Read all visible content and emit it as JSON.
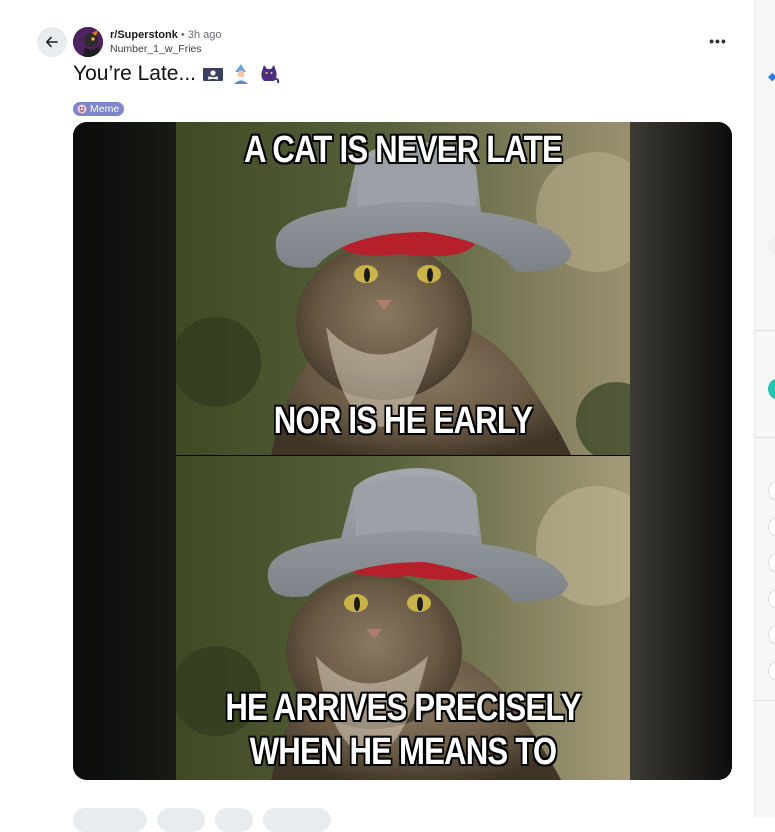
{
  "post": {
    "subreddit": "r/Superstonk",
    "separator": "•",
    "time_ago": "3h ago",
    "author": "Number_1_w_Fries",
    "title": "You’re Late...",
    "title_emojis": [
      "pirate-flag",
      "wizard",
      "black-cat"
    ],
    "flair": "Meme",
    "more_label": "•••"
  },
  "meme": {
    "top_caption_1": "A CAT IS NEVER LATE",
    "bottom_caption_1": "NOR IS HE EARLY",
    "top_caption_2": "HE ARRIVES PRECISELY",
    "bottom_caption_2": "WHEN HE MEANS TO"
  },
  "colors": {
    "flair_bg": "#7c86c8",
    "hat_gray": "#8e9398",
    "bandana_red": "#b5202a",
    "fur_brown": "#6e5b45"
  },
  "icons": {
    "back": "arrow-left-icon",
    "more": "ellipsis-icon",
    "flair": "meme-face-icon"
  }
}
